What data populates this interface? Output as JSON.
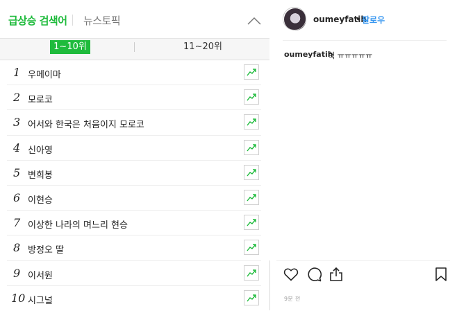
{
  "left_panel": {
    "tab_active": "급상승 검색어",
    "tab_other": "뉴스토픽",
    "range_active": "1~10위",
    "range_other": "11~20위",
    "ranks": [
      {
        "num": "1",
        "keyword": "우메이마"
      },
      {
        "num": "2",
        "keyword": "모로코"
      },
      {
        "num": "3",
        "keyword": "어서와 한국은 처음이지 모로코"
      },
      {
        "num": "4",
        "keyword": "신아영"
      },
      {
        "num": "5",
        "keyword": "변희봉"
      },
      {
        "num": "6",
        "keyword": "이현승"
      },
      {
        "num": "7",
        "keyword": "이상한 나라의 며느리 현승"
      },
      {
        "num": "8",
        "keyword": "방정오 딸"
      },
      {
        "num": "9",
        "keyword": "이서원"
      },
      {
        "num": "10",
        "keyword": "시그널"
      }
    ],
    "icons": {
      "collapse": "chevron-up-icon",
      "trend": "trend-chart-icon"
    },
    "colors": {
      "accent": "#1fbb3c"
    }
  },
  "right_panel": {
    "username": "oumeyfatih",
    "separator": "•",
    "follow_label": "팔로우",
    "caption_user": "oumeyfatih",
    "caption_text": "헉 ㅠㅠㅠㅠㅠ",
    "time": "9분 전",
    "icons": [
      "heart-icon",
      "comment-icon",
      "share-icon",
      "bookmark-icon"
    ],
    "colors": {
      "follow": "#3897f0"
    }
  }
}
